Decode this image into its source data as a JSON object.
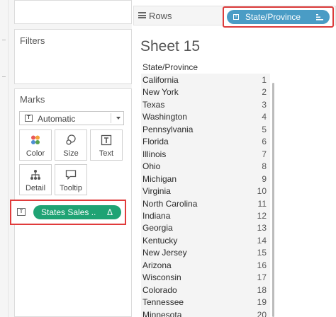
{
  "shelves": {
    "rows_label": "Rows",
    "rows_pill": "State/Province"
  },
  "filters": {
    "title": "Filters"
  },
  "marks": {
    "title": "Marks",
    "mark_type": "Automatic",
    "buttons": [
      {
        "label": "Color",
        "icon": "color-dots-icon"
      },
      {
        "label": "Size",
        "icon": "size-circles-icon"
      },
      {
        "label": "Text",
        "icon": "text-t-icon"
      },
      {
        "label": "Detail",
        "icon": "detail-nodes-icon"
      },
      {
        "label": "Tooltip",
        "icon": "speech-bubble-icon"
      }
    ],
    "text_pill": "States Sales ..",
    "text_pill_delta": "Δ"
  },
  "sheet": {
    "title": "Sheet 15",
    "column_header": "State/Province",
    "rows": [
      {
        "state": "California",
        "rank": "1"
      },
      {
        "state": "New York",
        "rank": "2"
      },
      {
        "state": "Texas",
        "rank": "3"
      },
      {
        "state": "Washington",
        "rank": "4"
      },
      {
        "state": "Pennsylvania",
        "rank": "5"
      },
      {
        "state": "Florida",
        "rank": "6"
      },
      {
        "state": "Illinois",
        "rank": "7"
      },
      {
        "state": "Ohio",
        "rank": "8"
      },
      {
        "state": "Michigan",
        "rank": "9"
      },
      {
        "state": "Virginia",
        "rank": "10"
      },
      {
        "state": "North Carolina",
        "rank": "11"
      },
      {
        "state": "Indiana",
        "rank": "12"
      },
      {
        "state": "Georgia",
        "rank": "13"
      },
      {
        "state": "Kentucky",
        "rank": "14"
      },
      {
        "state": "New Jersey",
        "rank": "15"
      },
      {
        "state": "Arizona",
        "rank": "16"
      },
      {
        "state": "Wisconsin",
        "rank": "17"
      },
      {
        "state": "Colorado",
        "rank": "18"
      },
      {
        "state": "Tennessee",
        "rank": "19"
      },
      {
        "state": "Minnesota",
        "rank": "20"
      }
    ]
  },
  "colors": {
    "green_pill": "#1fa374",
    "blue_pill": "#4a9cc5",
    "highlight_red": "#e03b3b"
  }
}
